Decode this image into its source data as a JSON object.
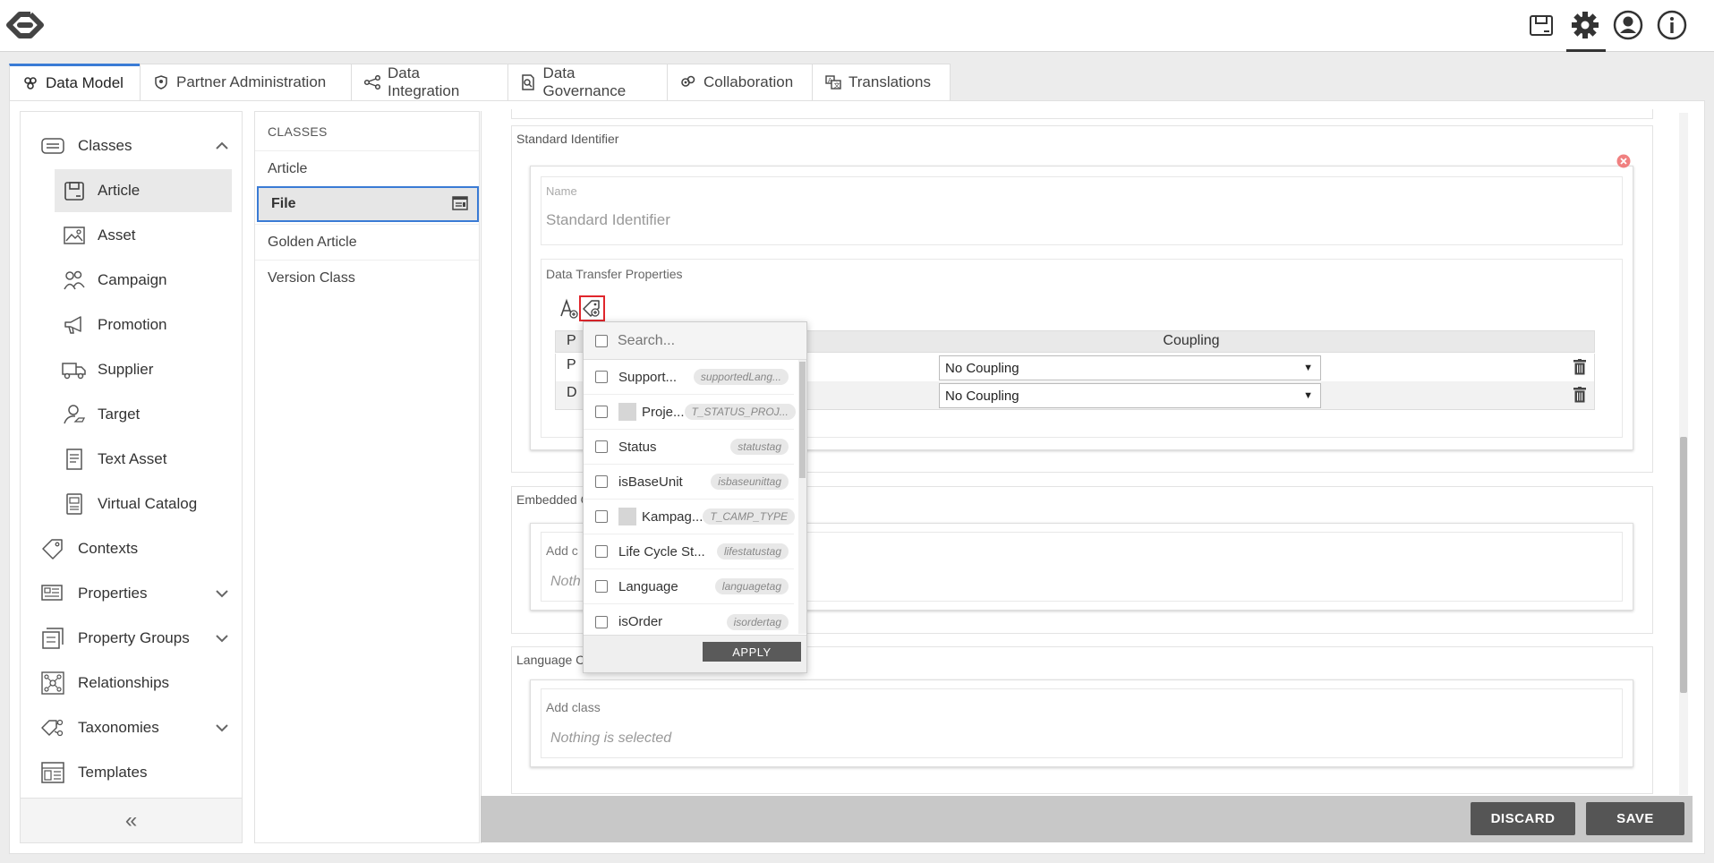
{
  "tabs": [
    {
      "label": "Data Model",
      "icon": "data-model-icon",
      "active": true
    },
    {
      "label": "Partner Administration",
      "icon": "shield-icon"
    },
    {
      "label": "Data Integration",
      "icon": "integration-icon"
    },
    {
      "label": "Data Governance",
      "icon": "governance-icon"
    },
    {
      "label": "Collaboration",
      "icon": "collaboration-icon"
    },
    {
      "label": "Translations",
      "icon": "translations-icon"
    }
  ],
  "sidebar": {
    "classes": "Classes",
    "sub": [
      "Article",
      "Asset",
      "Campaign",
      "Promotion",
      "Supplier",
      "Target",
      "Text Asset",
      "Virtual Catalog"
    ],
    "items": [
      "Contexts",
      "Properties",
      "Property Groups",
      "Relationships",
      "Taxonomies",
      "Templates"
    ],
    "collapse": "«"
  },
  "classlist": {
    "header": "CLASSES",
    "items": [
      "Article",
      "File",
      "Golden Article",
      "Version Class"
    ]
  },
  "content": {
    "standard_identifier_title": "Standard Identifier",
    "name_label": "Name",
    "name_placeholder": "Standard Identifier",
    "dtp_title": "Data Transfer Properties",
    "col_coupling": "Coupling",
    "col_p": "P",
    "row1_prefix": "P",
    "row2_prefix": "D",
    "row1_coupling": "No Coupling",
    "row2_coupling": "No Coupling",
    "embedded_title": "Embedded C",
    "embedded_add": "Add c",
    "embedded_nothing": "Noth",
    "language_title": "Language C",
    "language_add": "Add class",
    "language_nothing": "Nothing is selected"
  },
  "dropdown": {
    "search_placeholder": "Search...",
    "items": [
      {
        "label": "Support...",
        "tag": "supportedLang...",
        "swatch": false
      },
      {
        "label": "Proje...",
        "tag": "T_STATUS_PROJ...",
        "swatch": true
      },
      {
        "label": "Status",
        "tag": "statustag",
        "swatch": false
      },
      {
        "label": "isBaseUnit",
        "tag": "isbaseunittag",
        "swatch": false
      },
      {
        "label": "Kampag...",
        "tag": "T_CAMP_TYPE",
        "swatch": true
      },
      {
        "label": "Life Cycle St...",
        "tag": "lifestatustag",
        "swatch": false
      },
      {
        "label": "Language",
        "tag": "languagetag",
        "swatch": false
      },
      {
        "label": "isOrder",
        "tag": "isordertag",
        "swatch": false
      }
    ],
    "apply": "APPLY"
  },
  "footer": {
    "discard": "DISCARD",
    "save": "SAVE"
  },
  "colors": {
    "accent": "#3a7bd5",
    "highlight": "#e0262c",
    "remove": "#f08080"
  }
}
